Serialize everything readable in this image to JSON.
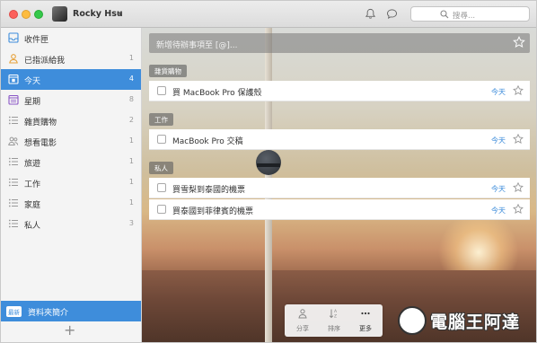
{
  "window": {
    "user": {
      "name": "Rocky Hsu",
      "caret": "▾"
    },
    "search": {
      "placeholder": "搜尋..."
    }
  },
  "sidebar": {
    "items": [
      {
        "label": "收件匣",
        "count": "",
        "icon": "inbox-icon",
        "active": false
      },
      {
        "label": "已指派給我",
        "count": "1",
        "icon": "person-icon",
        "active": false
      },
      {
        "label": "今天",
        "count": "4",
        "icon": "today-icon",
        "active": true
      },
      {
        "label": "星期",
        "count": "8",
        "icon": "calendar-week-icon",
        "active": false
      },
      {
        "label": "雜貨購物",
        "count": "2",
        "icon": "list-icon",
        "active": false
      },
      {
        "label": "想看電影",
        "count": "1",
        "icon": "people-icon",
        "active": false
      },
      {
        "label": "旅遊",
        "count": "1",
        "icon": "list-icon",
        "active": false
      },
      {
        "label": "工作",
        "count": "1",
        "icon": "list-icon",
        "active": false
      },
      {
        "label": "家庭",
        "count": "1",
        "icon": "list-icon",
        "active": false
      },
      {
        "label": "私人",
        "count": "3",
        "icon": "list-icon",
        "active": false
      }
    ],
    "bottom": {
      "badge": "最新",
      "label": "資料夾簡介"
    },
    "add_label": "+"
  },
  "main": {
    "add_placeholder": "新增待辦事項至 [@]...",
    "sections": [
      {
        "tag": "雜貨購物",
        "tasks": [
          {
            "title": "買 MacBook Pro 保護殼",
            "due": "今天"
          }
        ]
      },
      {
        "tag": "工作",
        "tasks": [
          {
            "title": "MacBook Pro 交稿",
            "due": "今天"
          }
        ]
      },
      {
        "tag": "私人",
        "tasks": [
          {
            "title": "買雪梨到泰國的機票",
            "due": "今天"
          },
          {
            "title": "買泰國到菲律賓的機票",
            "due": "今天"
          }
        ]
      }
    ],
    "toolbar": {
      "share": "分享",
      "sort": "排序",
      "more": "更多"
    }
  },
  "watermark": {
    "text": "電腦王阿達"
  },
  "colors": {
    "accent": "#3e8ddb",
    "sidebar_bg": "#f4f4f4",
    "titlebar_bg": "#e2e2e2"
  }
}
